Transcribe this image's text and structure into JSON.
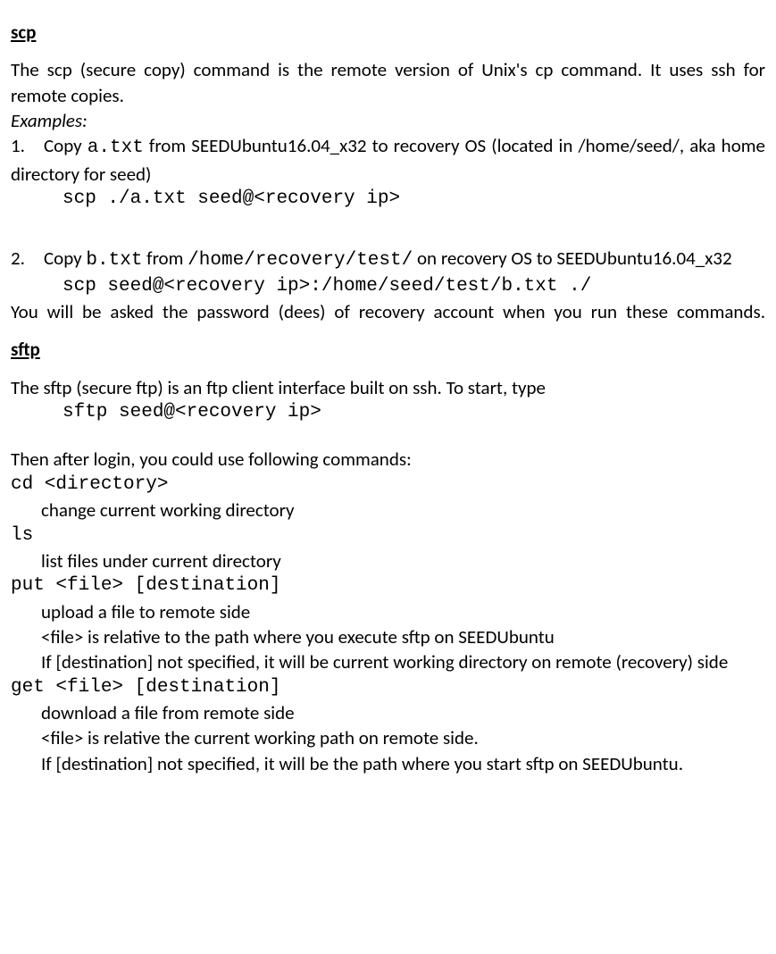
{
  "scp": {
    "title": "scp",
    "intro": "The scp (secure copy) command is the remote version of Unix's cp command. It uses ssh for remote copies.",
    "examples_label": "Examples:",
    "ex1_pre": "1. Copy ",
    "ex1_file": "a.txt",
    "ex1_post": " from SEEDUbuntu16.04_x32 to recovery OS (located in /home/seed/, aka home directory for seed)",
    "ex1_cmd": "scp ./a.txt seed@<recovery ip>",
    "ex2_pre": "2. Copy ",
    "ex2_file": "b.txt",
    "ex2_mid": " from ",
    "ex2_path": "/home/recovery/test/",
    "ex2_post": " on recovery OS to SEEDUbuntu16.04_x32",
    "ex2_cmd": "scp seed@<recovery ip>:/home/seed/test/b.txt ./",
    "note": "You will be asked the password (dees) of recovery account when you run these commands."
  },
  "sftp": {
    "title": "sftp",
    "intro": "The sftp (secure ftp) is an ftp client interface built on ssh. To start, type",
    "start_cmd": "sftp seed@<recovery ip>",
    "then": "Then after login, you could use following commands:",
    "cd_cmd": "cd <directory>",
    "cd_desc": "change current working directory",
    "ls_cmd": "ls",
    "ls_desc": "list files under current directory",
    "put_cmd": "put <file> [destination]",
    "put_d1": "upload a file to remote side",
    "put_d2": "<file> is relative to the path where you execute sftp on SEEDUbuntu",
    "put_d3": "If [destination] not specified, it will be current working directory on remote (recovery) side",
    "get_cmd": "get <file> [destination]",
    "get_d1": "download a file from remote side",
    "get_d2": "<file> is relative the current working path on remote side.",
    "get_d3": "If [destination] not specified, it will be the path where you start sftp on SEEDUbuntu."
  }
}
